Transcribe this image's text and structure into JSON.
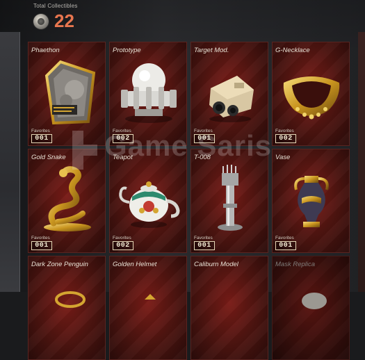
{
  "header": {
    "label": "Total Collectibles",
    "count": "22",
    "coin_icon": "medal-coin-icon"
  },
  "watermark": "Game Saris",
  "favorites_label": "Favorites",
  "cards": [
    {
      "name": "Phaethon",
      "favorites": "001",
      "icon": "carved-plaque-icon"
    },
    {
      "name": "Prototype",
      "favorites": "002",
      "icon": "white-reactor-icon"
    },
    {
      "name": "Target Mod.",
      "favorites": "001",
      "icon": "scope-module-icon"
    },
    {
      "name": "G-Necklace",
      "favorites": "002",
      "icon": "gold-necklace-icon"
    },
    {
      "name": "Gold Snake",
      "favorites": "001",
      "icon": "gold-snake-icon"
    },
    {
      "name": "Teapot",
      "favorites": "002",
      "icon": "teapot-icon"
    },
    {
      "name": "T-008",
      "favorites": "001",
      "icon": "robot-arm-icon"
    },
    {
      "name": "Vase",
      "favorites": "001",
      "icon": "amphora-vase-icon"
    },
    {
      "name": "Dark Zone Penguin",
      "favorites": "",
      "icon": "penguin-icon"
    },
    {
      "name": "Golden Helmet",
      "favorites": "",
      "icon": "golden-helmet-icon"
    },
    {
      "name": "Caliburn Model",
      "favorites": "",
      "icon": "sword-model-icon"
    },
    {
      "name": "Mask Replica",
      "favorites": "",
      "icon": "mask-icon"
    }
  ],
  "colors": {
    "count": "#e8764f",
    "card_bg": "#4c1410",
    "gold": "#d4a531"
  }
}
